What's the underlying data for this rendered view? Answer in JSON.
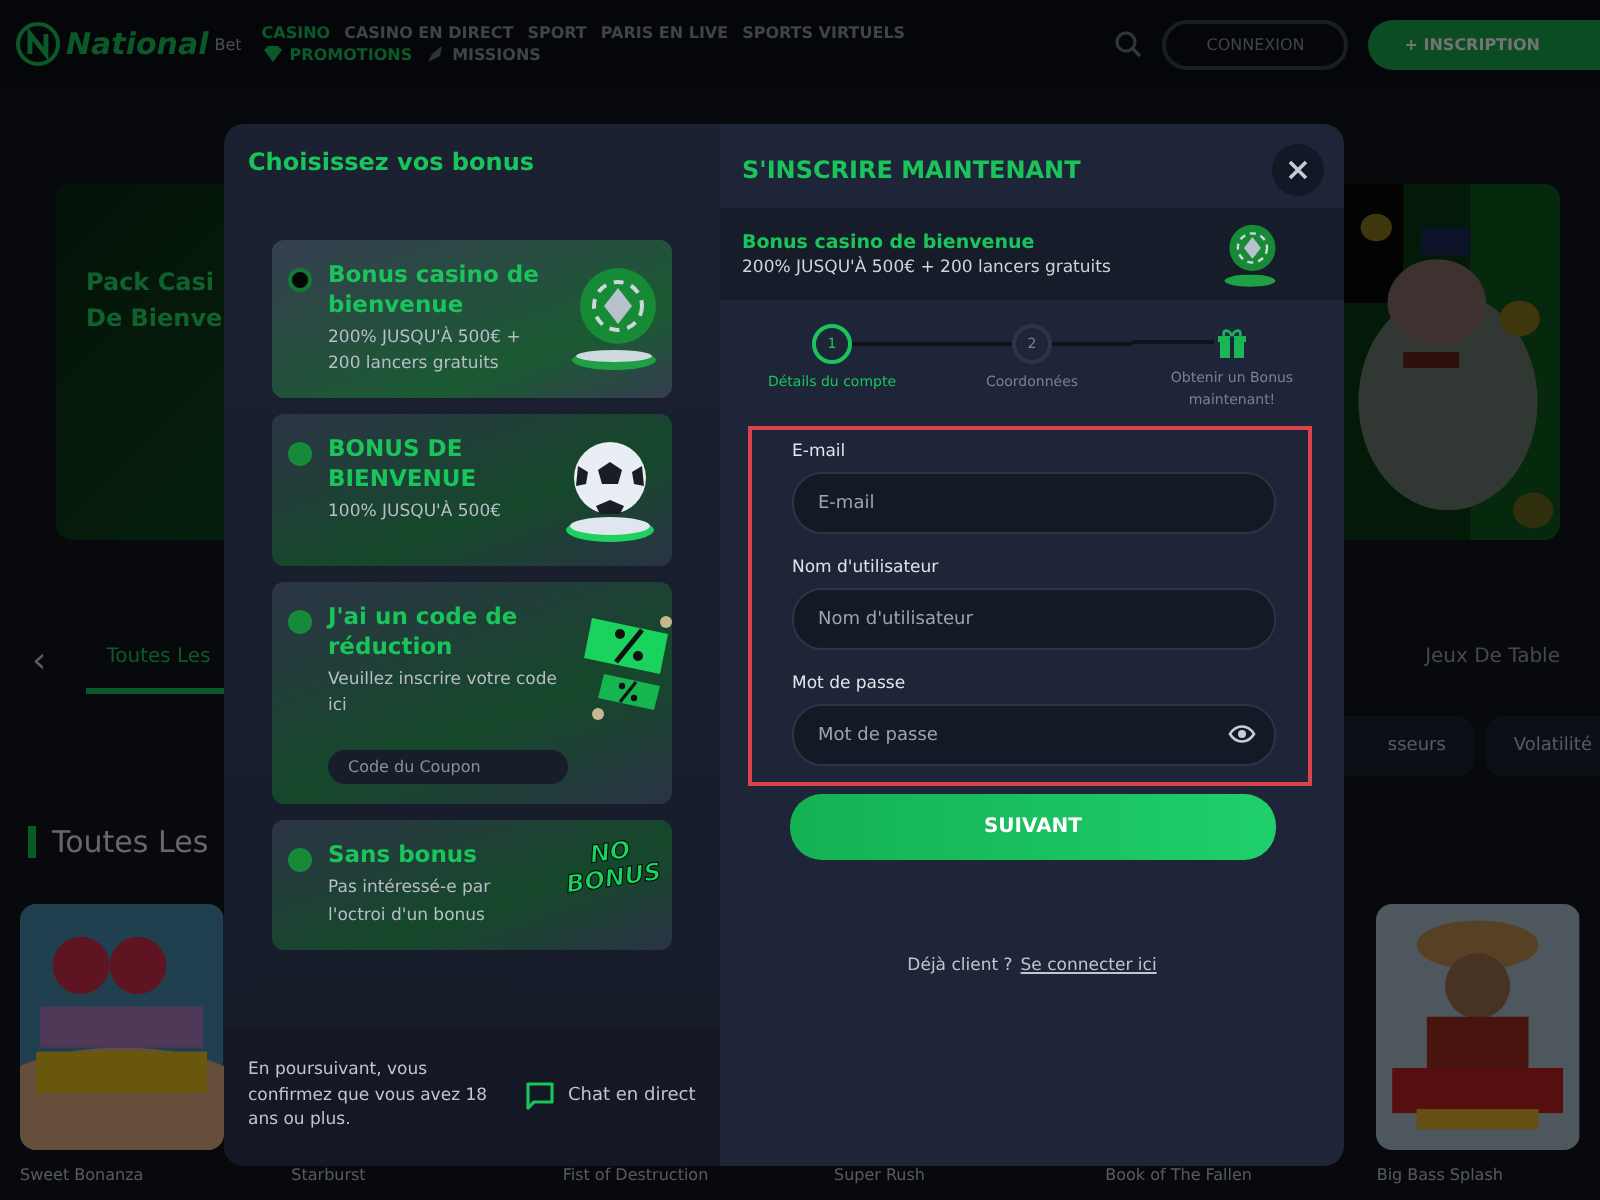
{
  "header": {
    "logo": "National",
    "logo_suffix": "Bet",
    "nav": [
      {
        "label": "CASINO",
        "selected": true
      },
      {
        "label": "CASINO EN DIRECT",
        "selected": false
      },
      {
        "label": "SPORT",
        "selected": false
      },
      {
        "label": "PARIS EN LIVE",
        "selected": false
      },
      {
        "label": "SPORTS VIRTUELS",
        "selected": false
      },
      {
        "label": "PROMOTIONS",
        "selected": true
      },
      {
        "label": "MISSIONS",
        "selected": false
      }
    ],
    "login": "CONNEXION",
    "register": "+ INSCRIPTION"
  },
  "banner": {
    "title_lines": [
      "Pack Casi",
      "De Bienve"
    ]
  },
  "tabs_prev": "‹",
  "category_tabs": [
    {
      "label": "Toutes Les",
      "selected": true
    },
    {
      "label": "Jeux De Table",
      "selected": false
    }
  ],
  "filters": [
    "sseurs",
    "Volatilité"
  ],
  "section_title": "Toutes Les",
  "games": [
    "Sweet Bonanza",
    "Starburst",
    "Fist of Destruction",
    "Super Rush",
    "Book of The Fallen",
    "Big Bass Splash"
  ],
  "modal": {
    "left_title": "Choisissez vos bonus",
    "bonuses": [
      {
        "title": "Bonus casino de bienvenue",
        "text": "200% JUSQU'À 500€ + 200 lancers gratuits",
        "selected": true,
        "kind": "chip"
      },
      {
        "title": "BONUS DE BIENVENUE",
        "text": "100% JUSQU'À 500€",
        "selected": false,
        "kind": "ball"
      },
      {
        "title": "J'ai un code de réduction",
        "text": "Veuillez inscrire votre code ici",
        "selected": false,
        "kind": "ticket",
        "coupon_placeholder": "Code du Coupon"
      },
      {
        "title": "Sans bonus",
        "text": "Pas intéressé-e par l'octroi d'un bonus",
        "selected": false,
        "kind": "nobonus",
        "sticker_text": "NO BONUS"
      }
    ],
    "age_note": "En poursuivant, vous confirmez que vous avez 18 ans ou plus.",
    "chat": "Chat en direct",
    "right_title": "S'INSCRIRE MAINTENANT",
    "chosen_bonus": {
      "title": "Bonus casino de bienvenue",
      "text": "200% JUSQU'À 500€ + 200 lancers gratuits"
    },
    "steps": [
      {
        "kind": "number",
        "number": "1",
        "label": "Détails du compte",
        "selected": true
      },
      {
        "kind": "number",
        "number": "2",
        "label": "Coordonnées",
        "selected": false
      },
      {
        "kind": "gift",
        "label": "Obtenir un Bonus maintenant!",
        "selected": false
      }
    ],
    "fields": [
      {
        "label": "E-mail",
        "placeholder": "E-mail",
        "kind": "text"
      },
      {
        "label": "Nom d'utilisateur",
        "placeholder": "Nom d'utilisateur",
        "kind": "text"
      },
      {
        "label": "Mot de passe",
        "placeholder": "Mot de passe",
        "kind": "password"
      }
    ],
    "submit": "SUIVANT",
    "login_prompt": "Déjà client ?",
    "login_link": "Se connecter ici"
  }
}
